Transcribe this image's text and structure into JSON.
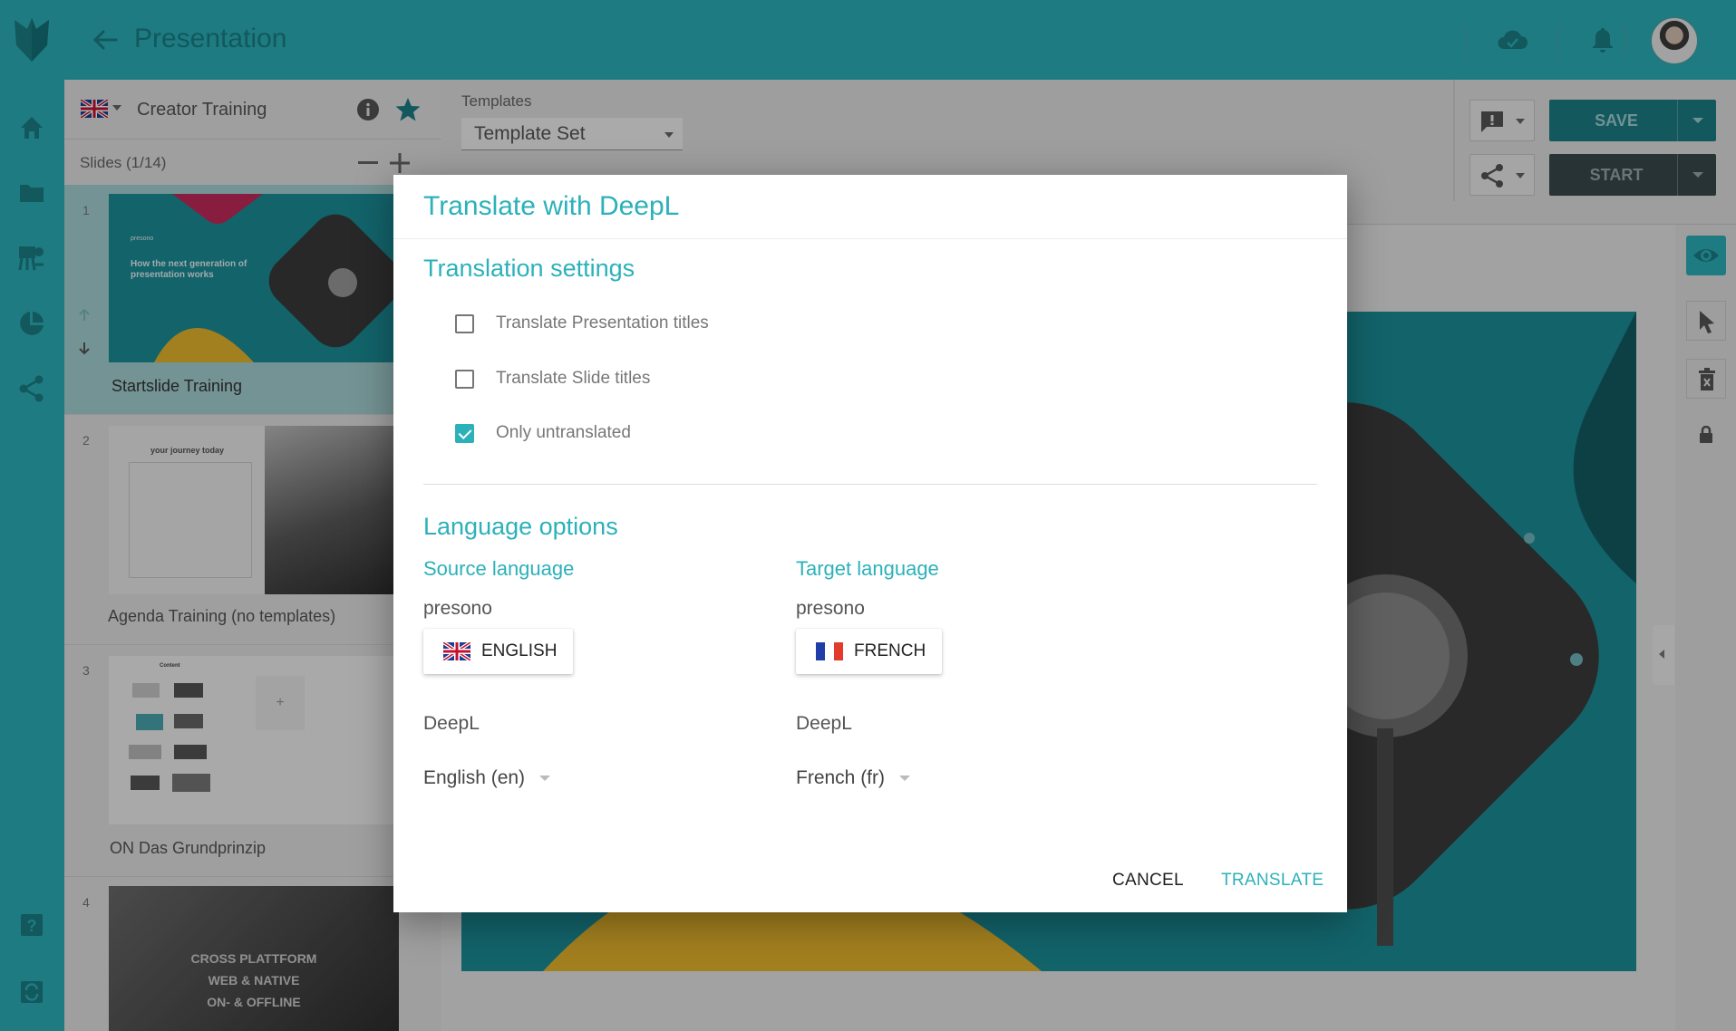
{
  "app": {
    "title": "Presentation"
  },
  "panel": {
    "title": "Creator Training",
    "slides_count": "Slides (1/14)"
  },
  "slides": [
    {
      "num": "1",
      "label": "Startslide Training",
      "thumb_brand": "presono",
      "thumb_text": "How the next generation of presentation works"
    },
    {
      "num": "2",
      "label": "Agenda Training (no templates)",
      "thumb_title": "your journey today"
    },
    {
      "num": "3",
      "label": "ON Das Grundprinzip",
      "thumb_title": "Content"
    },
    {
      "num": "4",
      "label": "",
      "thumb_lines": [
        "CROSS PLATTFORM",
        "WEB & NATIVE",
        "ON- & OFFLINE"
      ]
    }
  ],
  "toolbar": {
    "templates_label": "Templates",
    "template_value": "Template Set",
    "save_label": "SAVE",
    "start_label": "START"
  },
  "colors": {
    "accent": "#2cb1ba",
    "dark_accent": "#1a7f86",
    "checked": "#2cb1ba"
  },
  "modal": {
    "title": "Translate with DeepL",
    "settings_title": "Translation settings",
    "options": [
      {
        "label": "Translate Presentation titles",
        "checked": false
      },
      {
        "label": "Translate Slide titles",
        "checked": false
      },
      {
        "label": "Only untranslated",
        "checked": true
      }
    ],
    "language_title": "Language options",
    "source": {
      "title": "Source language",
      "provider": "presono",
      "button_label": "ENGLISH",
      "flag_icon": "uk-flag-icon",
      "engine": "DeepL",
      "select_value": "English (en)"
    },
    "target": {
      "title": "Target language",
      "provider": "presono",
      "button_label": "FRENCH",
      "flag_icon": "france-flag-icon",
      "engine": "DeepL",
      "select_value": "French (fr)"
    },
    "cancel_label": "CANCEL",
    "translate_label": "TRANSLATE"
  }
}
